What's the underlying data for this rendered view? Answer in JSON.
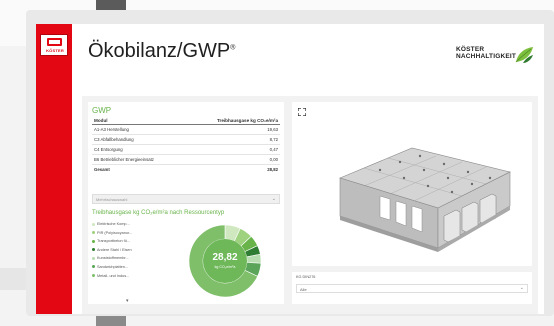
{
  "app": {
    "logo_text": "KÖSTER",
    "title": "Ökobilanz/GWP",
    "title_mark": "®",
    "brand_line1": "KÖSTER",
    "brand_line2": "NACHHALTIGKEIT"
  },
  "gwp": {
    "label": "GWP",
    "columns": [
      "Modul",
      "Treibhausgase kg CO₂e/m²a"
    ],
    "rows": [
      {
        "module": "A1-A3 Herstellung",
        "value": "19,63"
      },
      {
        "module": "C3 Abfallbehandlung",
        "value": "8,72"
      },
      {
        "module": "C4 Entsorgung",
        "value": "0,47"
      },
      {
        "module": "B6 Betrieblicher Energieeinsatz",
        "value": "0,00"
      }
    ],
    "total": {
      "module": "Gesamt",
      "value": "28,82"
    },
    "select_placeholder": "Mehrfachauswahl"
  },
  "resources": {
    "title": "Treibhausgase kg CO₂e/m²a nach Ressourcentyp",
    "items": [
      {
        "label": "Elektrische Komp...",
        "color": "#cfe8c0"
      },
      {
        "label": "PIR (Polyisocyanur...",
        "color": "#9ed27f"
      },
      {
        "label": "Transportbeton fü...",
        "color": "#68b34a"
      },
      {
        "label": "Andere Stahl / Eisen",
        "color": "#2e7d32"
      },
      {
        "label": "Kunststoffmembr...",
        "color": "#b8ddb0"
      },
      {
        "label": "Sandwichplatten...",
        "color": "#5aa55a"
      },
      {
        "label": "Metall- und Indus...",
        "color": "#7fbf6a"
      }
    ],
    "more_icon": "chevron-down-icon",
    "donut_value": "28,82",
    "donut_unit": "kg CO₂e/m²a",
    "donut_shares": [
      0.07,
      0.06,
      0.05,
      0.04,
      0.04,
      0.06,
      0.68
    ]
  },
  "viewer": {
    "expand_icon": "expand-icon",
    "filter_label": "KG DIN276",
    "filter_value": "Alle"
  },
  "colors": {
    "brand_red": "#e30613",
    "accent_green": "#68b34a"
  }
}
